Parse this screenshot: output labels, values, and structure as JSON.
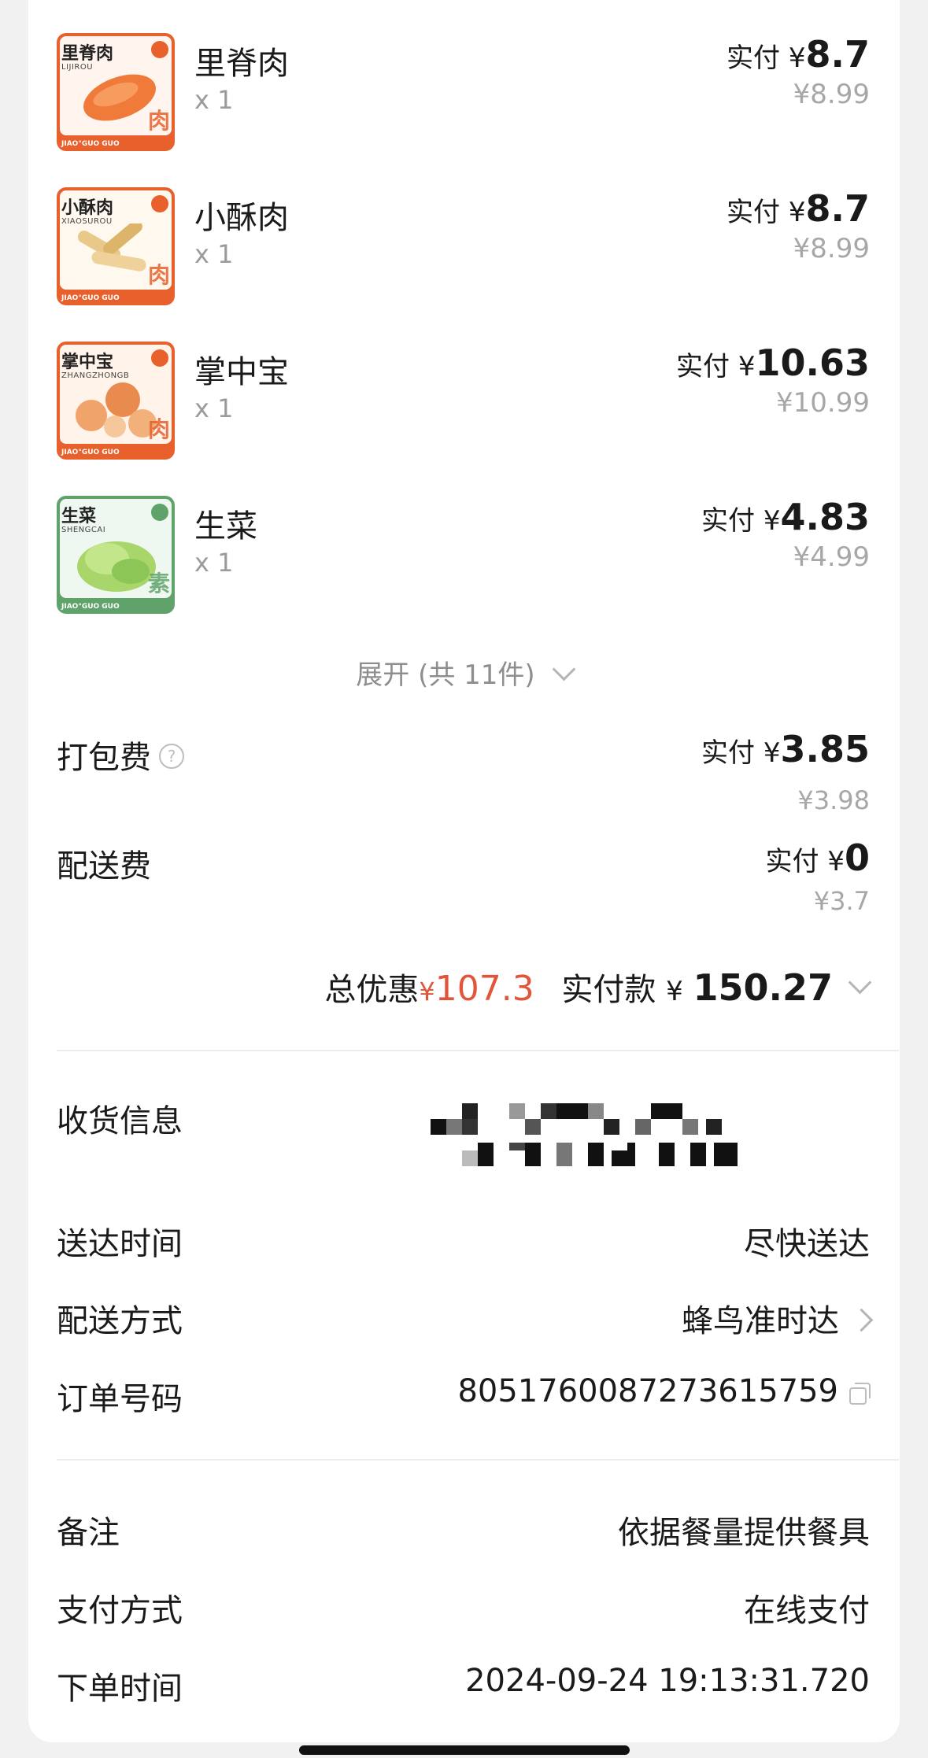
{
  "items": [
    {
      "name": "里脊肉",
      "qty": "x 1",
      "paid_prefix": "实付 ¥",
      "paid": "8.7",
      "original": "¥8.99",
      "thumb": {
        "title": "里脊肉",
        "sub": "LIJIROU",
        "tag": "肉",
        "footer": "JIAO°GUO GUO",
        "color": "#e8602c"
      }
    },
    {
      "name": "小酥肉",
      "qty": "x 1",
      "paid_prefix": "实付 ¥",
      "paid": "8.7",
      "original": "¥8.99",
      "thumb": {
        "title": "小酥肉",
        "sub": "XIAOSUROU",
        "tag": "肉",
        "footer": "JIAO°GUO GUO",
        "color": "#e8602c"
      }
    },
    {
      "name": "掌中宝",
      "qty": "x 1",
      "paid_prefix": "实付 ¥",
      "paid": "10.63",
      "original": "¥10.99",
      "thumb": {
        "title": "掌中宝",
        "sub": "ZHANGZHONGB",
        "tag": "肉",
        "footer": "JIAO°GUO GUO",
        "color": "#e8602c"
      }
    },
    {
      "name": "生菜",
      "qty": "x 1",
      "paid_prefix": "实付 ¥",
      "paid": "4.83",
      "original": "¥4.99",
      "thumb": {
        "title": "生菜",
        "sub": "SHENGCAI",
        "tag": "素",
        "footer": "JIAO°GUO GUO",
        "color": "#5fa36b"
      }
    }
  ],
  "expand_label": "展开 (共 11件)",
  "fees": {
    "packing": {
      "label": "打包费",
      "paid_prefix": "实付 ¥",
      "paid": "3.85",
      "original": "¥3.98"
    },
    "delivery": {
      "label": "配送费",
      "paid_prefix": "实付 ¥",
      "paid": "0",
      "original": "¥3.7"
    }
  },
  "totals": {
    "discount_label": "总优惠",
    "discount_currency": "¥",
    "discount": "107.3",
    "pay_label": "实付款",
    "pay_currency": "¥",
    "pay": "150.27"
  },
  "info": {
    "receiver_label": "收货信息",
    "time_label": "送达时间",
    "time_value": "尽快送达",
    "method_label": "配送方式",
    "method_value": "蜂鸟准时达",
    "order_label": "订单号码",
    "order_value": "8051760087273615759",
    "note_label": "备注",
    "note_value": "依据餐量提供餐具",
    "payment_label": "支付方式",
    "payment_value": "在线支付",
    "order_time_label": "下单时间",
    "order_time_value": "2024-09-24 19:13:31.720"
  },
  "colors": {
    "discount": "#e1553a",
    "meat_thumb": "#e8602c",
    "veg_thumb": "#5fa36b"
  }
}
